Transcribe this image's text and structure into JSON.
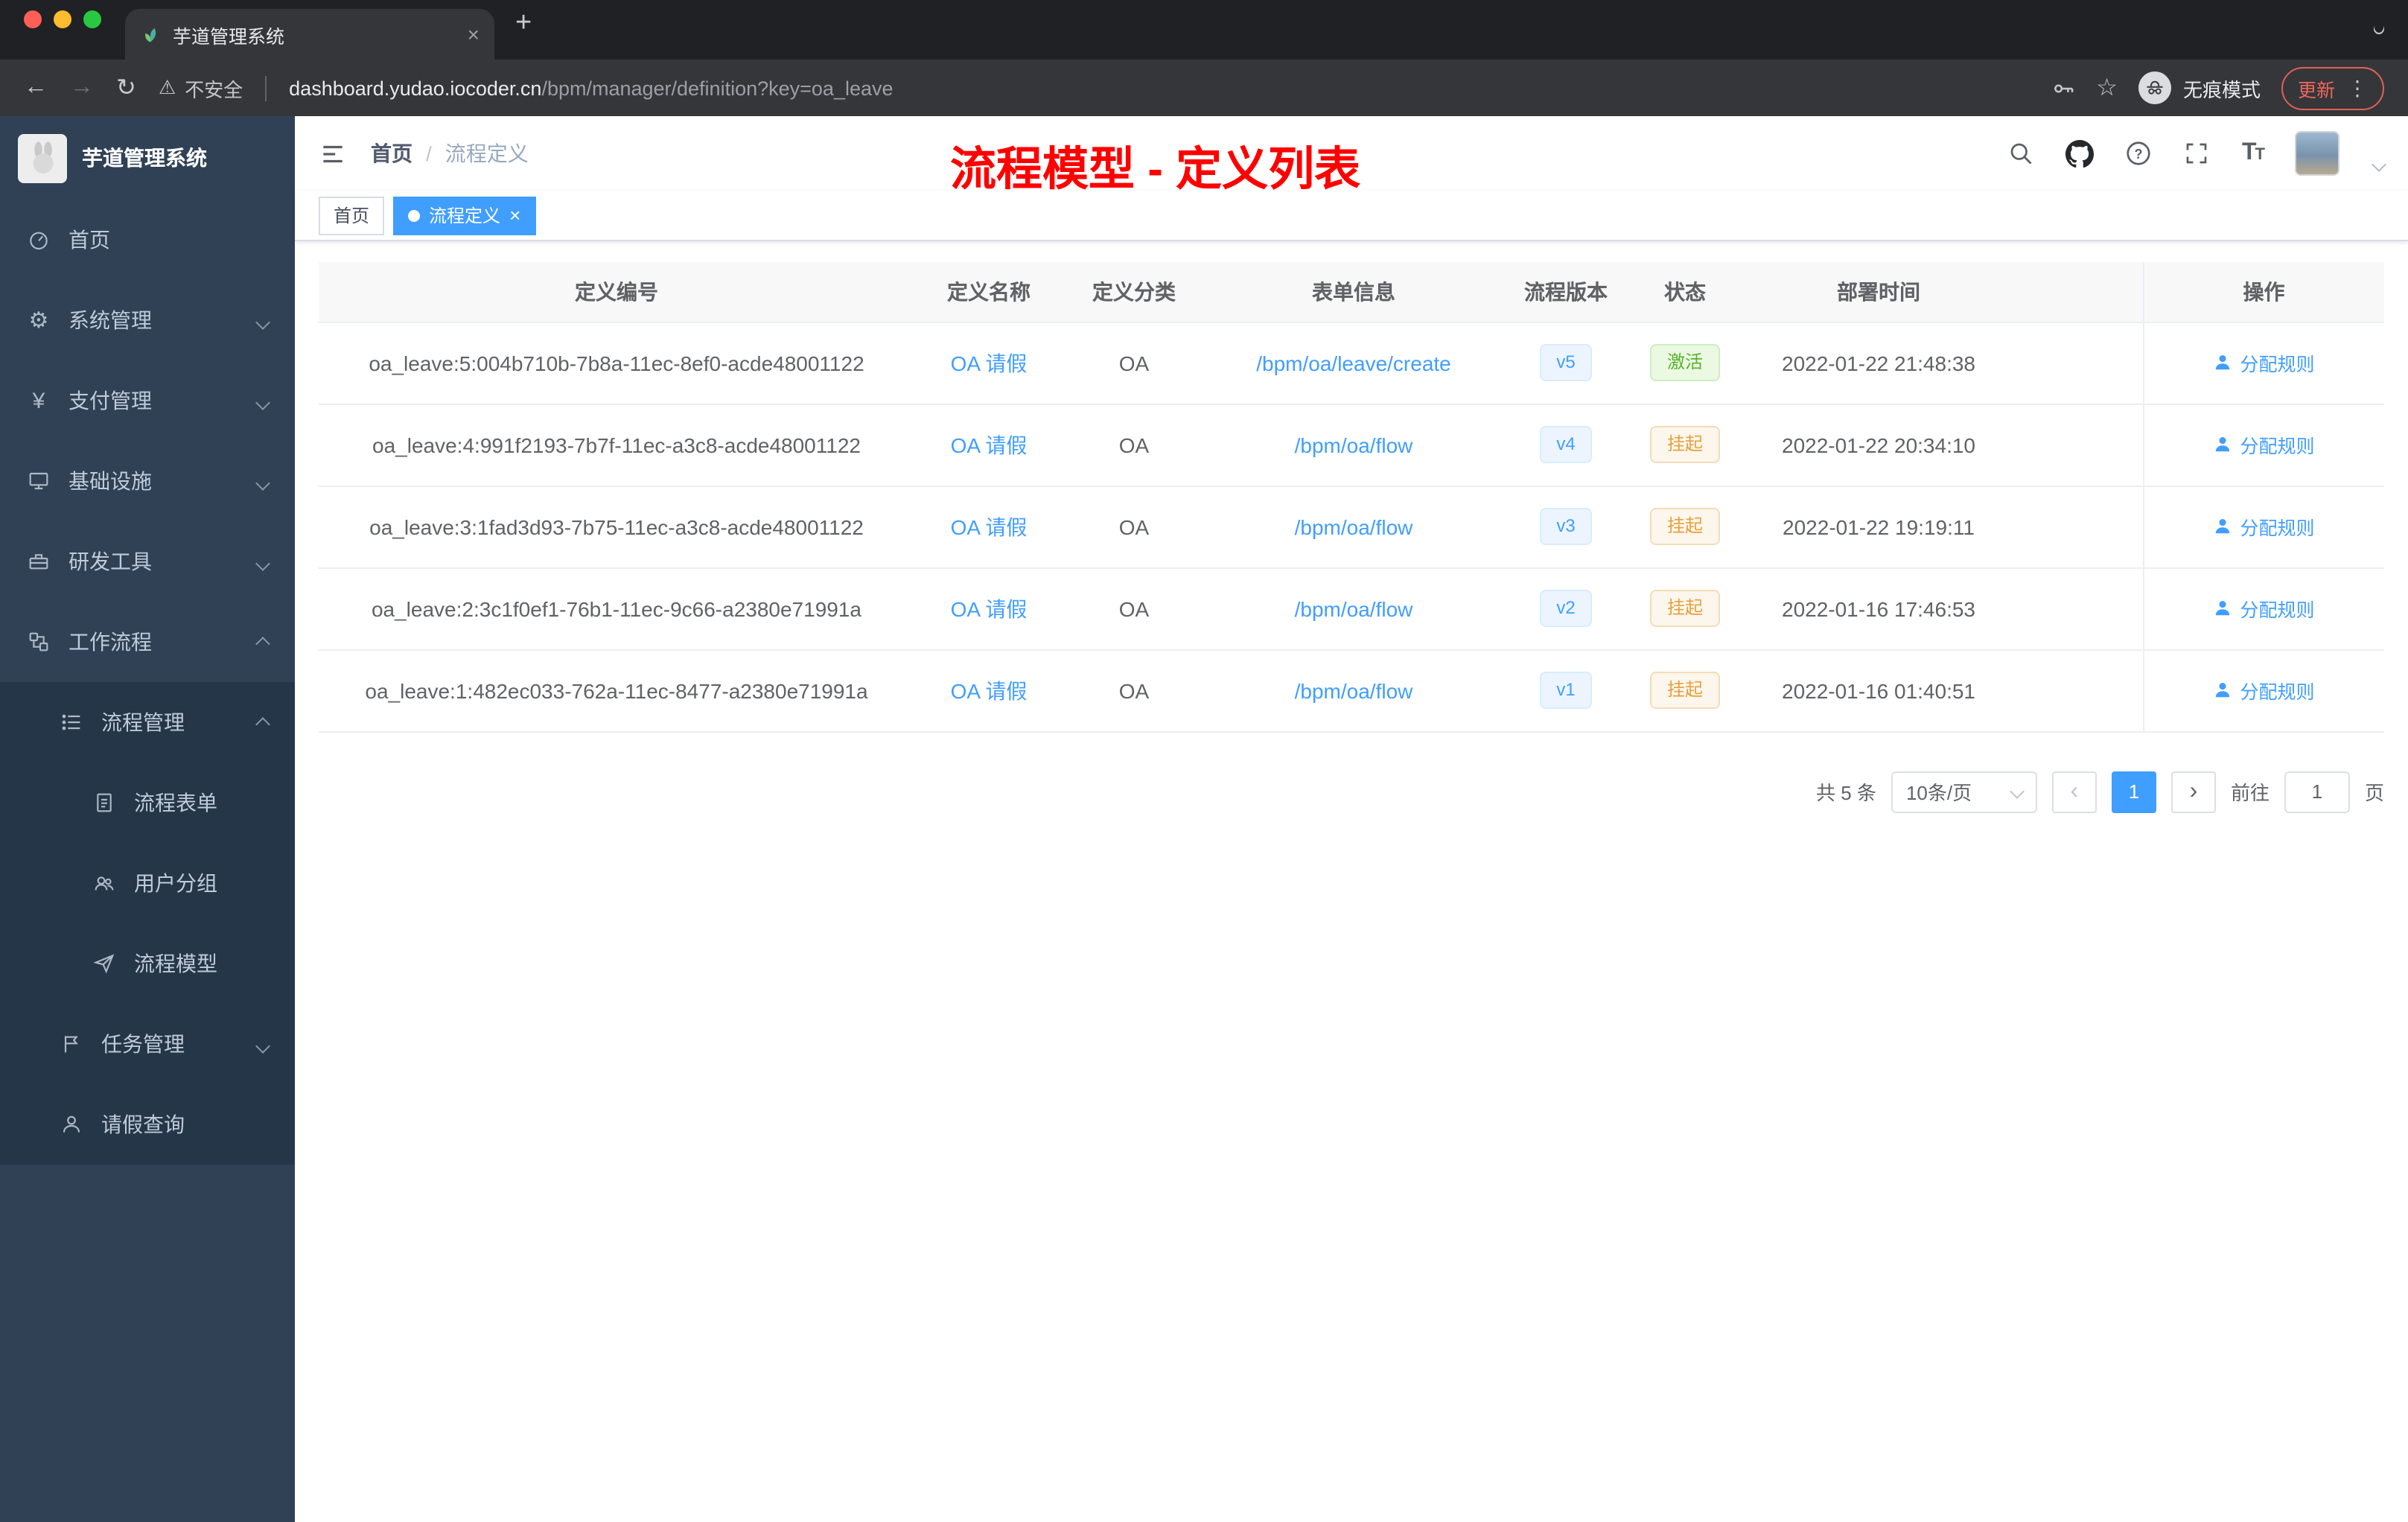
{
  "colors": {
    "accent": "#409eff",
    "annotation_red": "#ff0000",
    "success": "#67c23a",
    "warning": "#e6a23c"
  },
  "icons": {
    "close": "×",
    "plus": "+",
    "warning": "⚠",
    "star": "☆",
    "gear": "⚙",
    "yen": "¥",
    "overflow": "⋮",
    "prev": "‹",
    "next": "›",
    "back": "←",
    "forward": "→",
    "reload": "↻"
  },
  "browser": {
    "tab_title": "芋道管理系统",
    "security_label": "不安全",
    "url_host": "dashboard.yudao.iocoder.cn",
    "url_path": "/bpm/manager/definition?key=oa_leave",
    "incognito_label": "无痕模式",
    "update_label": "更新"
  },
  "sidebar": {
    "logo_title": "芋道管理系统",
    "items": [
      {
        "label": "首页"
      },
      {
        "label": "系统管理"
      },
      {
        "label": "支付管理"
      },
      {
        "label": "基础设施"
      },
      {
        "label": "研发工具"
      },
      {
        "label": "工作流程"
      },
      {
        "label": "流程管理"
      },
      {
        "label": "流程表单"
      },
      {
        "label": "用户分组"
      },
      {
        "label": "流程模型"
      },
      {
        "label": "任务管理"
      },
      {
        "label": "请假查询"
      }
    ]
  },
  "header": {
    "breadcrumb_home": "首页",
    "breadcrumb_sep": "/",
    "breadcrumb_current": "流程定义",
    "overlay_title": "流程模型 - 定义列表"
  },
  "tags": {
    "home": "首页",
    "active": "流程定义"
  },
  "table": {
    "columns": [
      "定义编号",
      "定义名称",
      "定义分类",
      "表单信息",
      "流程版本",
      "状态",
      "部署时间",
      "操作"
    ],
    "rows": [
      {
        "id": "oa_leave:5:004b710b-7b8a-11ec-8ef0-acde48001122",
        "name": "OA 请假",
        "category": "OA",
        "form": "/bpm/oa/leave/create",
        "version": "v5",
        "status": "激活",
        "status_type": "active",
        "deployed": "2022-01-22 21:48:38",
        "action": "分配规则"
      },
      {
        "id": "oa_leave:4:991f2193-7b7f-11ec-a3c8-acde48001122",
        "name": "OA 请假",
        "category": "OA",
        "form": "/bpm/oa/flow",
        "version": "v4",
        "status": "挂起",
        "status_type": "suspended",
        "deployed": "2022-01-22 20:34:10",
        "action": "分配规则"
      },
      {
        "id": "oa_leave:3:1fad3d93-7b75-11ec-a3c8-acde48001122",
        "name": "OA 请假",
        "category": "OA",
        "form": "/bpm/oa/flow",
        "version": "v3",
        "status": "挂起",
        "status_type": "suspended",
        "deployed": "2022-01-22 19:19:11",
        "action": "分配规则"
      },
      {
        "id": "oa_leave:2:3c1f0ef1-76b1-11ec-9c66-a2380e71991a",
        "name": "OA 请假",
        "category": "OA",
        "form": "/bpm/oa/flow",
        "version": "v2",
        "status": "挂起",
        "status_type": "suspended",
        "deployed": "2022-01-16 17:46:53",
        "action": "分配规则"
      },
      {
        "id": "oa_leave:1:482ec033-762a-11ec-8477-a2380e71991a",
        "name": "OA 请假",
        "category": "OA",
        "form": "/bpm/oa/flow",
        "version": "v1",
        "status": "挂起",
        "status_type": "suspended",
        "deployed": "2022-01-16 01:40:51",
        "action": "分配规则"
      }
    ]
  },
  "pagination": {
    "total_text": "共 5 条",
    "page_size": "10条/页",
    "page": "1",
    "goto_label": "前往",
    "goto_value": "1",
    "goto_unit": "页"
  }
}
